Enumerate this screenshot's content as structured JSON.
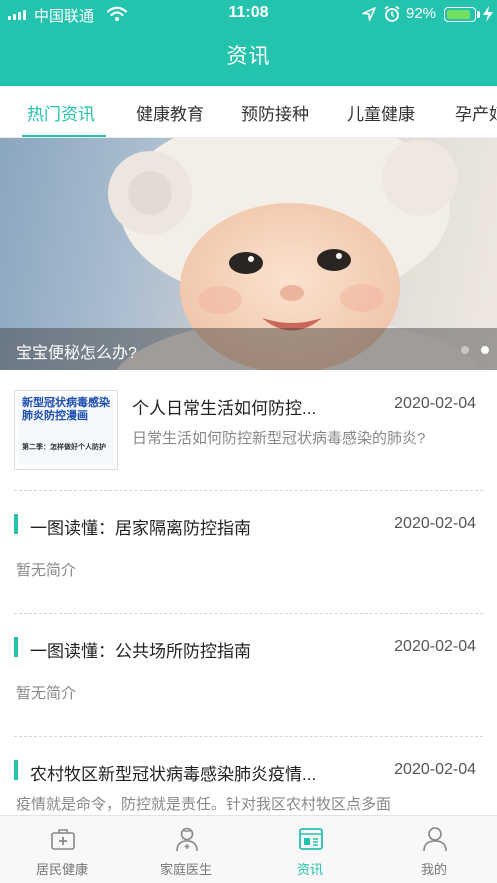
{
  "status_bar": {
    "carrier": "中国联通",
    "time": "11:08",
    "battery_percent": "92%",
    "battery_level": 0.92
  },
  "header": {
    "title": "资讯"
  },
  "tabs": [
    {
      "label": "热门资讯",
      "active": true
    },
    {
      "label": "健康教育",
      "active": false
    },
    {
      "label": "预防接种",
      "active": false
    },
    {
      "label": "儿童健康",
      "active": false
    },
    {
      "label": "孕产妇",
      "active": false
    }
  ],
  "banner": {
    "caption": "宝宝便秘怎么办?",
    "slide_count": 2,
    "active_slide": 2
  },
  "news": [
    {
      "title": "个人日常生活如何防控...",
      "date": "2020-02-04",
      "summary": "日常生活如何防控新型冠状病毒感染的肺炎?",
      "thumbnail": {
        "headline": "新型冠状病毒感染肺炎防控漫画",
        "subline": "第二季：怎样做好个人防护"
      }
    },
    {
      "title": "一图读懂：居家隔离防控指南",
      "date": "2020-02-04",
      "summary": "暂无简介"
    },
    {
      "title": "一图读懂：公共场所防控指南",
      "date": "2020-02-04",
      "summary": "暂无简介"
    },
    {
      "title": "农村牧区新型冠状病毒感染肺炎疫情...",
      "date": "2020-02-04",
      "summary": "疫情就是命令，防控就是责任。针对我区农村牧区点多面"
    }
  ],
  "bottom_nav": [
    {
      "label": "居民健康",
      "icon": "medical-kit-icon",
      "active": false
    },
    {
      "label": "家庭医生",
      "icon": "doctor-icon",
      "active": false
    },
    {
      "label": "资讯",
      "icon": "news-icon",
      "active": true
    },
    {
      "label": "我的",
      "icon": "user-icon",
      "active": false
    }
  ],
  "colors": {
    "accent": "#24c3ad",
    "battery_fill": "#6fe05f"
  }
}
